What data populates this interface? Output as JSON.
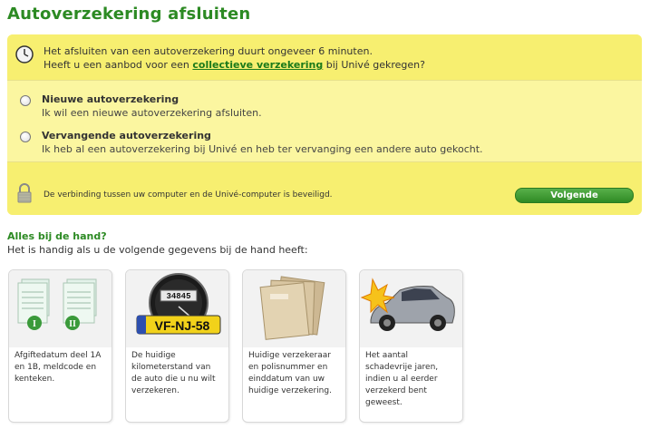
{
  "page": {
    "title": "Autoverzekering afsluiten"
  },
  "intro": {
    "line1": "Het afsluiten van een autoverzekering duurt ongeveer 6 minuten.",
    "line2_prefix": "Heeft u een aanbod voor een ",
    "link": "collectieve verzekering",
    "line2_suffix": " bij Univé gekregen?"
  },
  "options": [
    {
      "title": "Nieuwe autoverzekering",
      "subtitle": "Ik wil een nieuwe autoverzekering afsluiten."
    },
    {
      "title": "Vervangende autoverzekering",
      "subtitle": "Ik heb al een autoverzekering bij Univé en heb ter vervanging een andere auto gekocht."
    }
  ],
  "security": {
    "text": "De verbinding tussen uw computer en de Univé-computer is beveiligd."
  },
  "button": {
    "label": "Volgende"
  },
  "section": {
    "title": "Alles bij de hand?",
    "subtitle": "Het is handig als u de volgende gegevens bij de hand heeft:"
  },
  "cards": [
    {
      "text": "Afgiftedatum deel 1A en 1B, meldcode en kenteken.",
      "icon": "registration-documents-icon"
    },
    {
      "text": "De huidige kilometerstand van de auto die u nu wilt verzekeren.",
      "icon": "odometer-icon",
      "meter": "34845",
      "plate": "VF-NJ-58"
    },
    {
      "text": "Huidige verzekeraar en polisnummer en einddatum van uw huidige verzekering.",
      "icon": "envelopes-icon"
    },
    {
      "text": "Het aantal schadevrije jaren, indien u al eerder verzekerd bent geweest.",
      "icon": "crashed-car-icon"
    }
  ],
  "colors": {
    "brand_green": "#2c8a23",
    "panel_yellow": "#fbf6a0",
    "band_yellow": "#f7ef70"
  }
}
